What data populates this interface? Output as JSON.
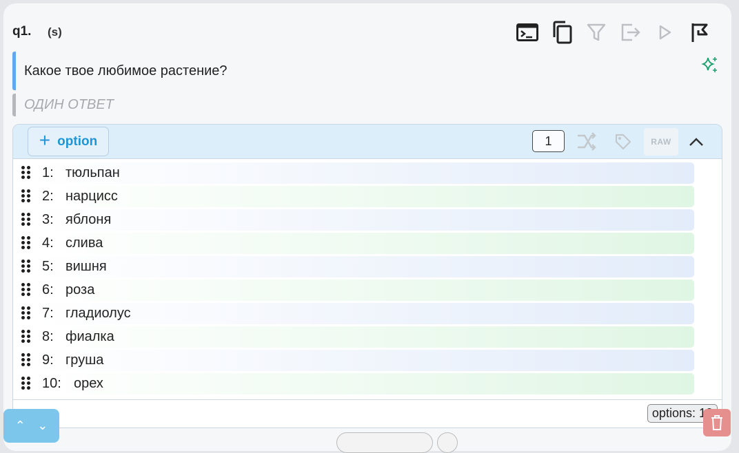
{
  "question": {
    "number": "q1.",
    "type_code": "(s)",
    "text": "Какое твое любимое растение?",
    "answer_type": "ОДИН ОТВЕТ"
  },
  "toolbar": {
    "icons": [
      "terminal-icon",
      "copy-icon",
      "filter-icon",
      "exit-icon",
      "play-icon",
      "flag-icon"
    ]
  },
  "options_panel": {
    "add_label": "option",
    "count_value": "1",
    "raw_label": "RAW",
    "count_badge": "options: 10",
    "items": [
      {
        "num": "1:",
        "label": "тюльпан"
      },
      {
        "num": "2:",
        "label": "нарцисс"
      },
      {
        "num": "3:",
        "label": "яблоня"
      },
      {
        "num": "4:",
        "label": "слива"
      },
      {
        "num": "5:",
        "label": "вишня"
      },
      {
        "num": "6:",
        "label": "роза"
      },
      {
        "num": "7:",
        "label": "гладиолус"
      },
      {
        "num": "8:",
        "label": "фиалка"
      },
      {
        "num": "9:",
        "label": "груша"
      },
      {
        "num": "10:",
        "label": "орех"
      }
    ]
  },
  "colors": {
    "accent_blue": "#1e96d6",
    "question_bar": "#5fa8f0",
    "sparkle": "#1aa06d"
  }
}
